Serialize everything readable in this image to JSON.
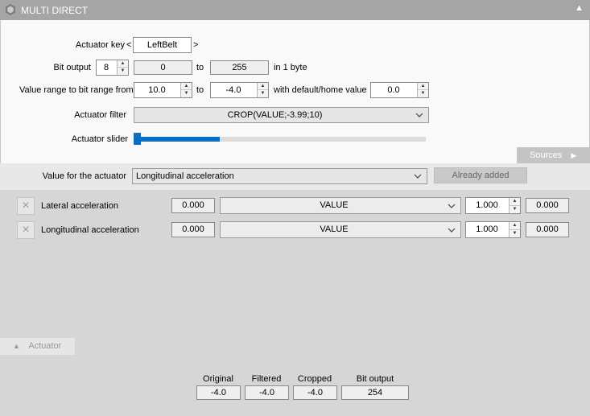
{
  "window": {
    "title": "MULTI DIRECT",
    "collapse_icon": "triangle-up-icon"
  },
  "actuator_key": {
    "label": "Actuator key",
    "prev": "<",
    "value": "LeftBelt",
    "next": ">"
  },
  "bit_output": {
    "label": "Bit output",
    "bits": "8",
    "from": "0",
    "to_label": "to",
    "to": "255",
    "suffix": "in 1 byte"
  },
  "value_range": {
    "label": "Value range to bit range from",
    "from": "10.0",
    "to_label": "to",
    "to": "-4.0",
    "default_label": "with default/home value",
    "default": "0.0"
  },
  "actuator_filter": {
    "label": "Actuator filter",
    "value": "CROP(VALUE;-3.99;10)"
  },
  "actuator_slider": {
    "label": "Actuator slider",
    "level": 0.02
  },
  "sources_button": {
    "label": "Sources",
    "icon": "triangle-right-icon"
  },
  "value_for_actuator": {
    "label": "Value for the actuator",
    "selected": "Longitudinal acceleration",
    "added_label": "Already added"
  },
  "inputs": [
    {
      "name": "Lateral acceleration",
      "current": "0.000",
      "mode": "VALUE",
      "factor": "1.000",
      "result": "0.000"
    },
    {
      "name": "Longitudinal acceleration",
      "current": "0.000",
      "mode": "VALUE",
      "factor": "1.000",
      "result": "0.000"
    }
  ],
  "actuator_tab": {
    "label": "Actuator",
    "icon": "triangle-up-icon"
  },
  "readouts": [
    {
      "label": "Original",
      "value": "-4.0"
    },
    {
      "label": "Filtered",
      "value": "-4.0"
    },
    {
      "label": "Cropped",
      "value": "-4.0"
    },
    {
      "label": "Bit output",
      "value": "254"
    }
  ],
  "colors": {
    "accent": "#0a6fc2",
    "titlebar": "#a5a5a5"
  }
}
